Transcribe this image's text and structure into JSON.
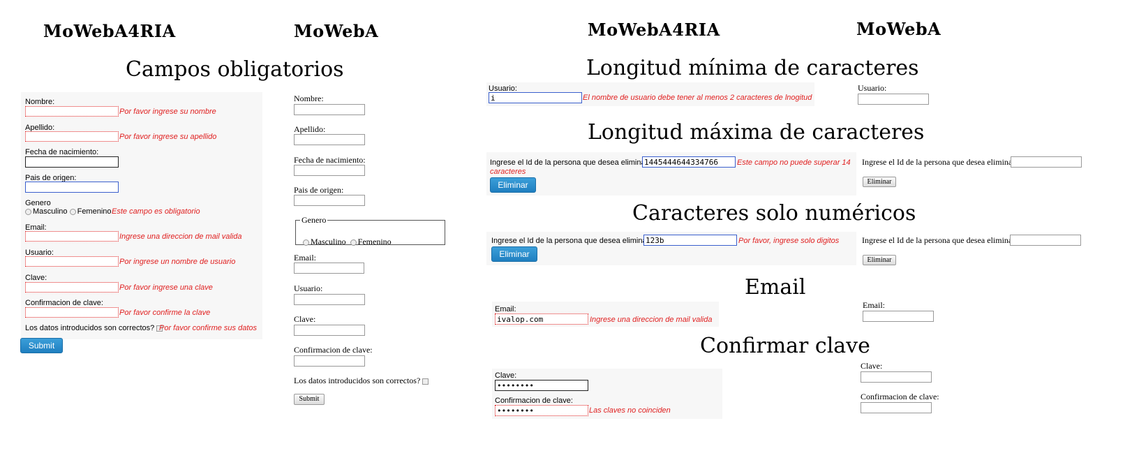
{
  "brands": {
    "a": "MoWebA4RIA",
    "b": "MoWebA"
  },
  "sections": {
    "required": "Campos obligatorios",
    "minlength": "Longitud mínima de caracteres",
    "maxlength": "Longitud máxima de caracteres",
    "numeric": "Caracteres solo numéricos",
    "email": "Email",
    "confirm": "Confirmar clave"
  },
  "required_form": {
    "nombre": {
      "label": "Nombre:",
      "error": "Por favor ingrese su nombre"
    },
    "apellido": {
      "label": "Apellido:",
      "error": "Por favor ingrese su apellido"
    },
    "fecha": {
      "label": "Fecha de nacimiento:"
    },
    "pais": {
      "label": "Pais de origen:"
    },
    "genero": {
      "label": "Genero",
      "opt1": "Masculino",
      "opt2": "Femenino",
      "error": "Este campo  es obligatorio"
    },
    "email": {
      "label": "Email:",
      "error": "Ingrese una direccion de mail valida"
    },
    "usuario": {
      "label": "Usuario:",
      "error": "Por ingrese un nombre de usuario"
    },
    "clave": {
      "label": "Clave:",
      "error": "Por favor ingrese una clave"
    },
    "confirmacion": {
      "label": "Confirmacion de clave:",
      "error": "Por favor confirme la clave"
    },
    "datos": {
      "label": "Los datos introducidos son correctos?",
      "error": "Por favor confirme sus datos"
    },
    "submit": "Submit"
  },
  "required_form_b": {
    "nombre": "Nombre:",
    "apellido": "Apellido:",
    "fecha": "Fecha de nacimiento:",
    "pais": "Pais de origen:",
    "genero": "Genero",
    "opt1": "Masculino",
    "opt2": "Femenino",
    "email": "Email:",
    "usuario": "Usuario:",
    "clave": "Clave:",
    "confirmacion": "Confirmacion de clave:",
    "datos": "Los datos introducidos son correctos?",
    "submit": "Submit"
  },
  "minlength": {
    "label": "Usuario:",
    "value": "i",
    "error": "El nombre de usuario debe tener al menos 2 caracteres de lnogitud",
    "b_label": "Usuario:"
  },
  "maxlength": {
    "label": "Ingrese el Id de la persona que desea eliminar:",
    "value": "1445444644334766",
    "error_line1": "Este campo no puede superar 14",
    "error_line2": "caracteres",
    "button": "Eliminar",
    "b_label": "Ingrese el Id de la persona que desea eliminar:",
    "b_button": "Eliminar"
  },
  "numeric": {
    "label": "Ingrese el Id de la persona que desea eliminar:",
    "value": "123b",
    "error": "Por favor, ingrese solo digitos",
    "button": "Eliminar",
    "b_label": "Ingrese el Id de la persona que desea eliminar:",
    "b_button": "Eliminar"
  },
  "email": {
    "label": "Email:",
    "value": "ivalop.com",
    "error": "Ingrese una direccion de mail valida",
    "b_label": "Email:"
  },
  "confirm": {
    "clave_label": "Clave:",
    "clave_value": "••••••••",
    "conf_label": "Confirmacion de clave:",
    "conf_value": "••••••••",
    "error": "Las claves no coinciden",
    "b_clave_label": "Clave:",
    "b_conf_label": "Confirmacion de clave:"
  },
  "colors": {
    "error": "#e02020",
    "focus": "#3a5fcd",
    "button": "#2a8bcc"
  }
}
